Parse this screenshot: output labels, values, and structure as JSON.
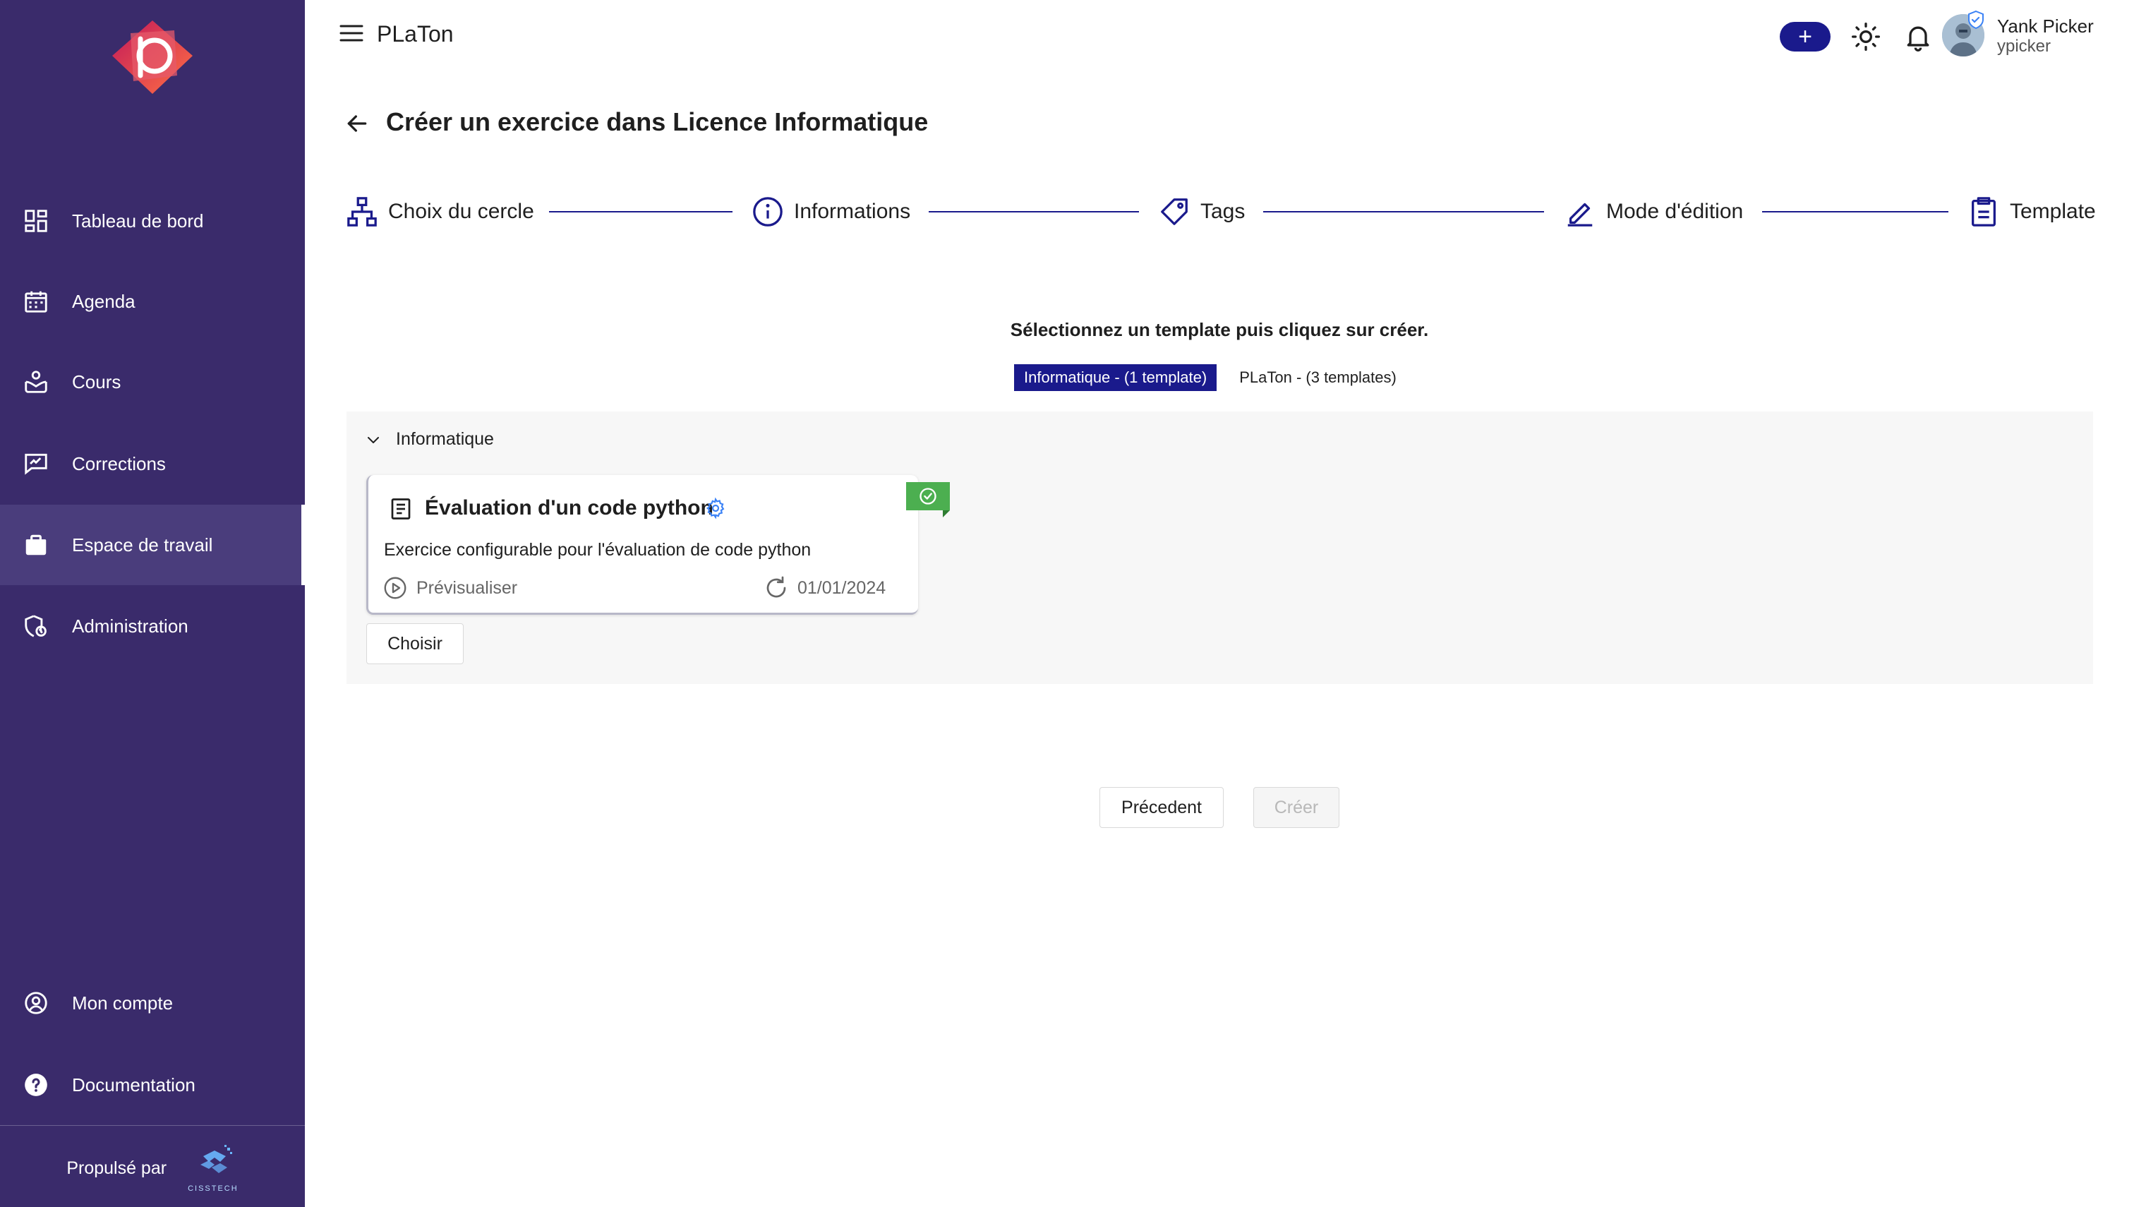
{
  "colors": {
    "sidebar_bg": "#3a2b6b",
    "sidebar_active_bg": "#4a3d7c",
    "primary": "#1a1a8c",
    "success": "#4caf50",
    "panel_bg": "#f7f7f7"
  },
  "header": {
    "app_title": "PLaTon",
    "menu_icon": "hamburger-menu-icon",
    "add_button_label": "+",
    "user": {
      "name": "Yank Picker",
      "login": "ypicker"
    }
  },
  "sidebar": {
    "items": [
      {
        "label": "Tableau de bord",
        "icon": "dashboard-icon",
        "active": false
      },
      {
        "label": "Agenda",
        "icon": "calendar-icon",
        "active": false
      },
      {
        "label": "Cours",
        "icon": "course-icon",
        "active": false
      },
      {
        "label": "Corrections",
        "icon": "corrections-icon",
        "active": false
      },
      {
        "label": "Espace de travail",
        "icon": "briefcase-icon",
        "active": true
      },
      {
        "label": "Administration",
        "icon": "admin-icon",
        "active": false
      }
    ],
    "bottom_items": [
      {
        "label": "Mon compte",
        "icon": "account-icon"
      },
      {
        "label": "Documentation",
        "icon": "help-icon"
      }
    ],
    "powered_by": {
      "text": "Propulsé par",
      "brand": "CISSTECH"
    }
  },
  "page": {
    "title": "Créer un exercice dans Licence Informatique",
    "steps": [
      {
        "label": "Choix du cercle",
        "icon": "hierarchy-icon"
      },
      {
        "label": "Informations",
        "icon": "info-icon"
      },
      {
        "label": "Tags",
        "icon": "tag-icon"
      },
      {
        "label": "Mode d'édition",
        "icon": "pencil-icon"
      },
      {
        "label": "Template",
        "icon": "clipboard-icon"
      }
    ],
    "instruction": "Sélectionnez un template puis cliquez sur créer.",
    "tabs": [
      {
        "label": "Informatique - (1 template)",
        "active": true
      },
      {
        "label": "PLaTon - (3 templates)",
        "active": false
      }
    ],
    "group": {
      "label": "Informatique",
      "expanded": true,
      "card": {
        "title": "Évaluation d'un code python",
        "description": "Exercice configurable pour l'évaluation de code python",
        "preview_label": "Prévisualiser",
        "date": "01/01/2024",
        "selected": true
      },
      "choose_label": "Choisir"
    },
    "actions": {
      "previous_label": "Précedent",
      "create_label": "Créer"
    }
  }
}
